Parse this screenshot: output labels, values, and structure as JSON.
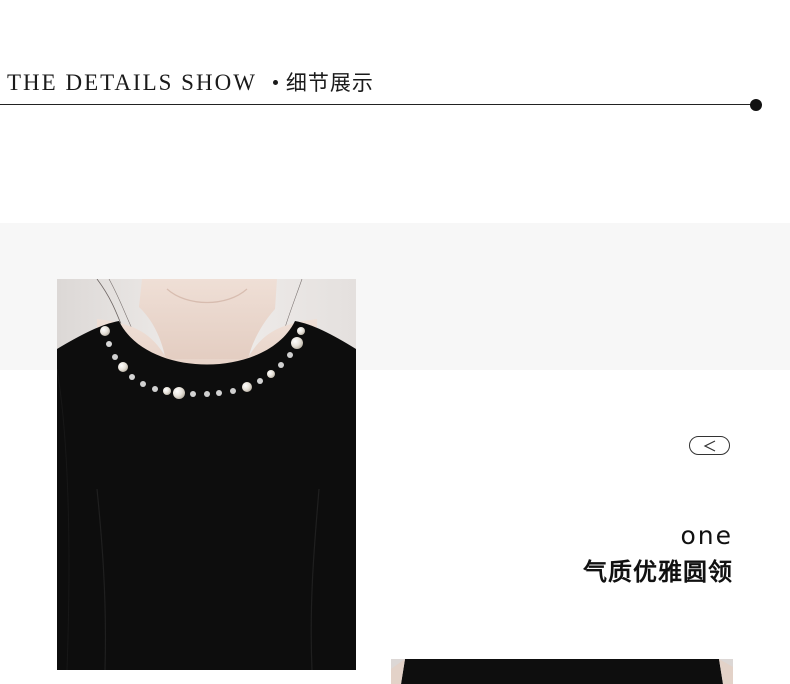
{
  "header": {
    "title_en": "THE DETAILS SHOW",
    "title_cn": "细节展示"
  },
  "navigation": {
    "prev_icon": "chevron-left-icon"
  },
  "feature": {
    "index_word": "one",
    "title": "气质优雅圆领"
  },
  "images": {
    "main": "dress-neckline-photo",
    "second": "dress-detail-photo"
  },
  "colors": {
    "text": "#111111",
    "band": "#f7f7f7",
    "dress": "#0d0d0d",
    "skin": "#e9d6cc",
    "pearl": "#e8e4dc"
  }
}
